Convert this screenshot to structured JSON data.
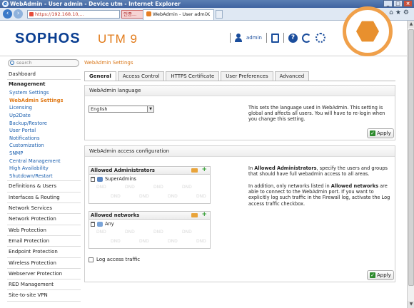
{
  "window": {
    "title": "WebAdmin - User admin - Device utm - Internet Explorer"
  },
  "browser": {
    "address": "https://192.168.10,...",
    "cert_label": "인증...",
    "tab_label": "WebAdmin - User admi...",
    "tab_close": "×"
  },
  "header": {
    "logo": "SOPHOS",
    "product": "UTM 9",
    "user": "admin"
  },
  "search": {
    "placeholder": "search"
  },
  "breadcrumb": "WebAdmin Settings",
  "sidebar": {
    "dashboard": "Dashboard",
    "management": "Management",
    "management_items": [
      "System Settings",
      "WebAdmin Settings",
      "Licensing",
      "Up2Date",
      "Backup/Restore",
      "User Portal",
      "Notifications",
      "Customization",
      "SNMP",
      "Central Management",
      "High Availability",
      "Shutdown/Restart"
    ],
    "sections": [
      "Definitions & Users",
      "Interfaces & Routing",
      "Network Services",
      "Network Protection",
      "Web Protection",
      "Email Protection",
      "Endpoint Protection",
      "Wireless Protection",
      "Webserver Protection",
      "RED Management",
      "Site-to-site VPN"
    ]
  },
  "tabs": [
    "General",
    "Access Control",
    "HTTPS Certificate",
    "User Preferences",
    "Advanced"
  ],
  "language_panel": {
    "title": "WebAdmin language",
    "selected": "English",
    "description": "This sets the language used in WebAdmin. This setting is global and affects all users. You will have to re-login when you change this setting.",
    "apply": "Apply"
  },
  "access_panel": {
    "title": "WebAdmin access configuration",
    "admins_title": "Allowed Administrators",
    "admins_entry": "SuperAdmins",
    "networks_title": "Allowed networks",
    "networks_entry": "Any",
    "dnd": "DND",
    "desc1_pre": "In ",
    "desc1_bold": "Allowed Administrators",
    "desc1_post": ", specify the users and groups that should have full webadmin access to all areas.",
    "desc2_pre": "In addition, only networks listed in ",
    "desc2_bold": "Allowed networks",
    "desc2_post": " are able to connect to the WebAdmin port. If you want to explicitly log such traffic in the Firewall log, activate the Log access traffic checkbox.",
    "log_label": "Log access traffic",
    "apply": "Apply"
  }
}
